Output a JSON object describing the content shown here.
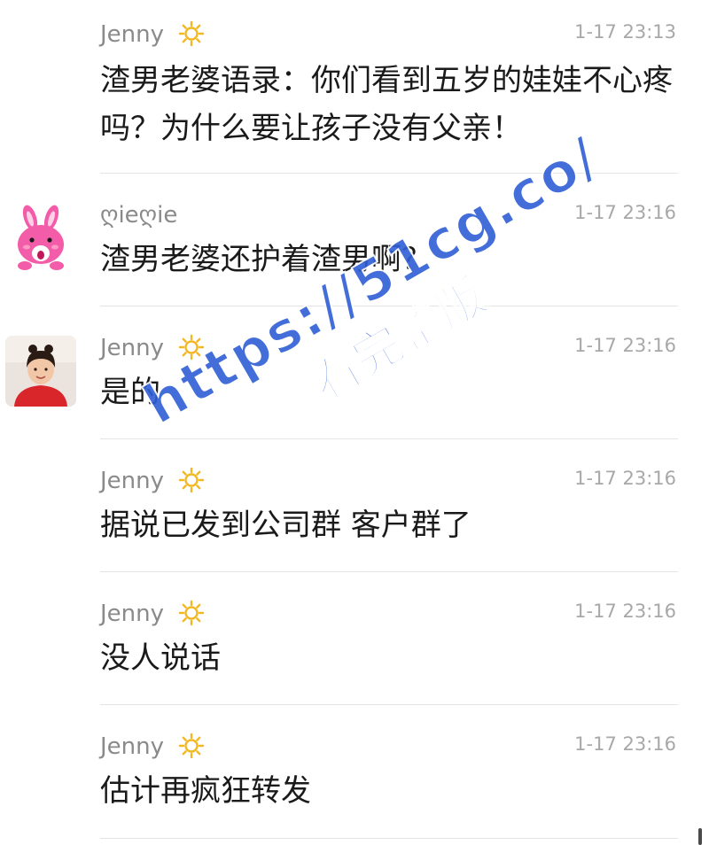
{
  "messages": [
    {
      "username": "Jenny",
      "time": "1-17 23:13",
      "text": "渣男老婆语录：你们看到五岁的娃娃不心疼吗？为什么要让孩子没有父亲！",
      "avatar": "none"
    },
    {
      "username": "ღieღie",
      "time": "1-17 23:16",
      "text": "渣男老婆还护着渣男啊？",
      "avatar": "pink-bunny"
    },
    {
      "username": "Jenny",
      "time": "1-17 23:16",
      "text": "是的",
      "avatar": "girl-photo"
    },
    {
      "username": "Jenny",
      "time": "1-17 23:16",
      "text": "据说已发到公司群 客户群了",
      "avatar": "none"
    },
    {
      "username": "Jenny",
      "time": "1-17 23:16",
      "text": "没人说话",
      "avatar": "none"
    },
    {
      "username": "Jenny",
      "time": "1-17 23:16",
      "text": "估计再疯狂转发",
      "avatar": "none"
    }
  ],
  "watermark": {
    "url": "https://51cg.co/",
    "subtitle": "看完整版"
  },
  "colors": {
    "username": "#8a8a8a",
    "time": "#a8a8a8",
    "text": "#1a1a1a",
    "divider": "#e4e4e4",
    "watermark": "#2f5fd6",
    "sun_badge": "#f2b824"
  }
}
